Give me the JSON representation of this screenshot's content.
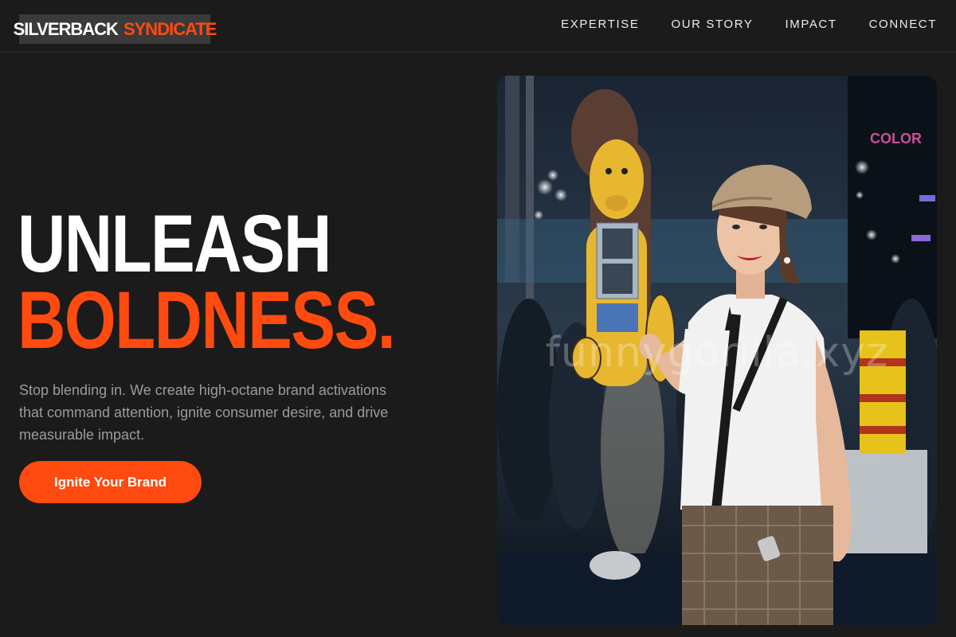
{
  "header": {
    "logo_primary": "SILVERBACK",
    "logo_accent": "SYNDICATE",
    "nav": [
      "EXPERTISE",
      "OUR STORY",
      "IMPACT",
      "CONNECT"
    ]
  },
  "hero": {
    "title_line1": "UNLEASH",
    "title_line2": "BOLDNESS.",
    "subtitle": "Stop blending in. We create high-octane brand activations that command attention, ignite consumer desire, and drive measurable impact.",
    "cta_label": "Ignite Your Brand"
  },
  "photo": {
    "watermark": "funnygorilla.xyz",
    "description_icon": "promo-model-photo"
  },
  "colors": {
    "background": "#1b1b1b",
    "accent": "#ff4a10",
    "text_primary": "#ffffff",
    "text_muted": "#9b9b9b"
  }
}
